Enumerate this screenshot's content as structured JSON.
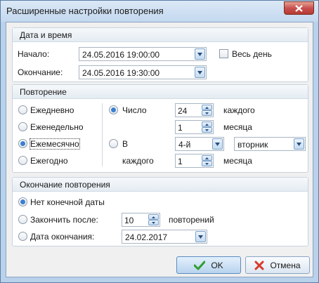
{
  "window": {
    "title": "Расширенные настройки повторения"
  },
  "datetime_group": {
    "header": "Дата и время",
    "start_label": "Начало:",
    "start_value": "24.05.2016 19:00:00",
    "end_label": "Окончание:",
    "end_value": "24.05.2016 19:30:00",
    "allday_label": "Весь день"
  },
  "repeat_group": {
    "header": "Повторение",
    "daily": "Ежедневно",
    "weekly": "Еженедельно",
    "monthly": "Ежемесячно",
    "yearly": "Ежегодно",
    "number_label": "Число",
    "number_value": "24",
    "each_label": "каждого",
    "months_value": "1",
    "month_label": "месяца",
    "in_label": "В",
    "ordinal_value": "4-й",
    "weekday_value": "вторник",
    "each2_label": "каждого",
    "months2_value": "1",
    "month2_label": "месяца"
  },
  "end_group": {
    "header": "Окончание повторения",
    "no_end_label": "Нет конечной даты",
    "end_after_label": "Закончить после:",
    "occurrences_value": "10",
    "occurrences_label": "повторений",
    "end_date_label": "Дата окончания:",
    "end_date_value": "24.02.2017"
  },
  "buttons": {
    "ok": "OK",
    "cancel": "Отмена"
  },
  "colors": {
    "accent": "#3a7fd0",
    "ok_icon": "#2f9e2f",
    "cancel_icon": "#d83a2a"
  }
}
